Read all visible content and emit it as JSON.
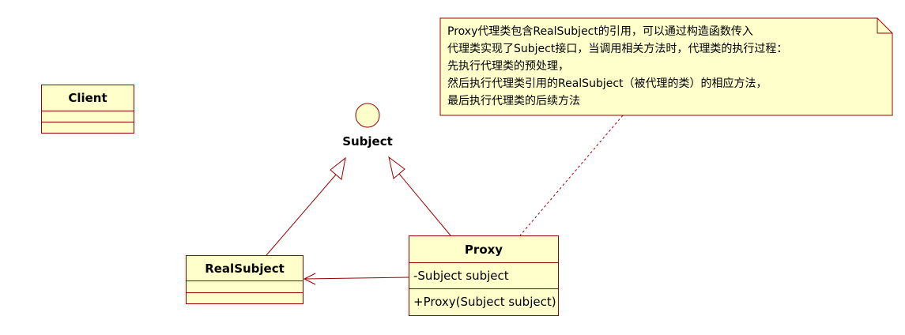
{
  "diagram": {
    "client": {
      "name": "Client"
    },
    "subject_interface": {
      "name": "Subject"
    },
    "real_subject": {
      "name": "RealSubject"
    },
    "proxy": {
      "name": "Proxy",
      "attribute": "-Subject subject",
      "operation": "+Proxy(Subject subject)"
    },
    "note": {
      "lines": [
        "Proxy代理类包含RealSubject的引用，可以通过构造函数传入",
        "代理类实现了Subject接口，当调用相关方法时，代理类的执行过程：",
        "先执行代理类的预处理，",
        "然后执行代理类引用的RealSubject（被代理的类）的相应方法，",
        "最后执行代理类的后续方法"
      ]
    }
  },
  "colors": {
    "box_fill": "#ffffcc",
    "box_border": "#990000",
    "line": "#990000"
  }
}
